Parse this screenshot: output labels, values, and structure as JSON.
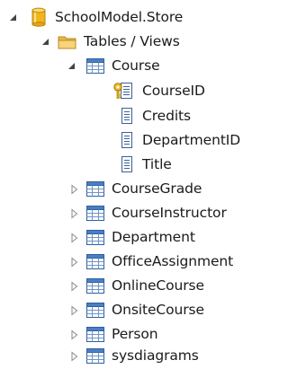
{
  "tree": {
    "root": {
      "label": "SchoolModel.Store",
      "expanded": true,
      "icon": "database-icon"
    },
    "folder": {
      "label": "Tables / Views",
      "expanded": true,
      "icon": "folder-icon"
    },
    "course": {
      "label": "Course",
      "expanded": true,
      "icon": "table-icon",
      "columns": [
        {
          "label": "CourseID",
          "icon": "primary-key-column-icon"
        },
        {
          "label": "Credits",
          "icon": "column-icon"
        },
        {
          "label": "DepartmentID",
          "icon": "column-icon"
        },
        {
          "label": "Title",
          "icon": "column-icon"
        }
      ]
    },
    "tables": [
      {
        "label": "CourseGrade",
        "expanded": false,
        "icon": "table-icon"
      },
      {
        "label": "CourseInstructor",
        "expanded": false,
        "icon": "table-icon"
      },
      {
        "label": "Department",
        "expanded": false,
        "icon": "table-icon"
      },
      {
        "label": "OfficeAssignment",
        "expanded": false,
        "icon": "table-icon"
      },
      {
        "label": "OnlineCourse",
        "expanded": false,
        "icon": "table-icon"
      },
      {
        "label": "OnsiteCourse",
        "expanded": false,
        "icon": "table-icon"
      },
      {
        "label": "Person",
        "expanded": false,
        "icon": "table-icon"
      },
      {
        "label": "sysdiagrams",
        "expanded": false,
        "icon": "table-icon"
      }
    ]
  }
}
